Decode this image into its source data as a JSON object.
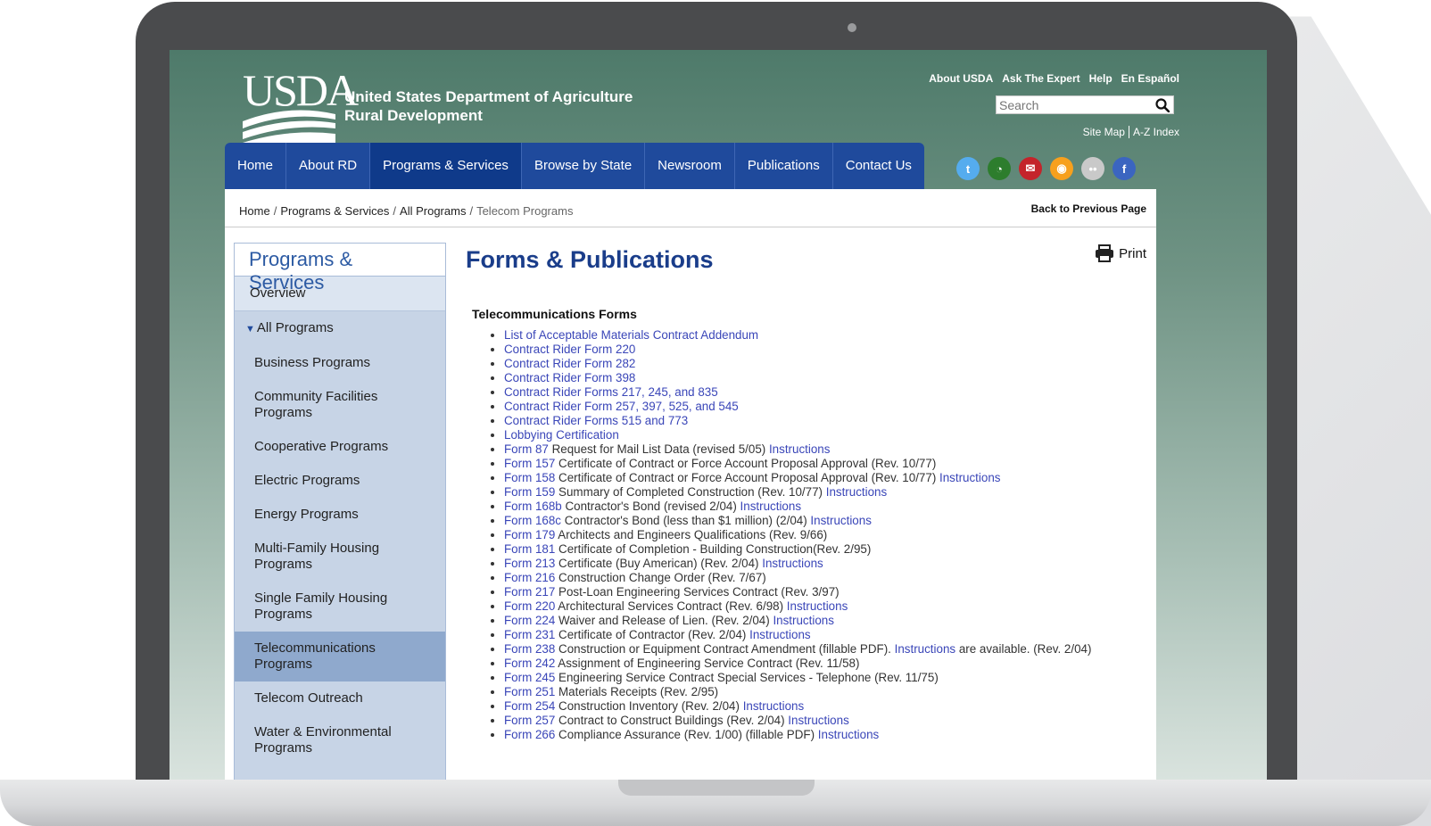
{
  "header": {
    "logo_text": "USDA",
    "agency_line1": "United States Department of Agriculture",
    "agency_line2": "Rural Development",
    "util_links": [
      "About USDA",
      "Ask The Expert",
      "Help",
      "En Español"
    ],
    "search_placeholder": "Search",
    "site_map": "Site Map",
    "az_index": "A-Z Index"
  },
  "nav": {
    "items": [
      "Home",
      "About RD",
      "Programs & Services",
      "Browse by State",
      "Newsroom",
      "Publications",
      "Contact Us"
    ],
    "active": "Programs & Services"
  },
  "social": [
    {
      "name": "twitter-icon",
      "glyph": "t",
      "color": "#55acee"
    },
    {
      "name": "feed-icon",
      "glyph": "◔",
      "color": "#2d7d2d"
    },
    {
      "name": "email-icon",
      "glyph": "✉",
      "color": "#c4242b"
    },
    {
      "name": "rss-icon",
      "glyph": "◉",
      "color": "#f7a01d"
    },
    {
      "name": "flickr-icon",
      "glyph": "••",
      "color": "#c9c9c9"
    },
    {
      "name": "facebook-icon",
      "glyph": "f",
      "color": "#3b65c0"
    }
  ],
  "breadcrumb": {
    "items": [
      "Home",
      "Programs & Services",
      "All Programs"
    ],
    "current": "Telecom Programs",
    "back": "Back to Previous Page"
  },
  "sidebar": {
    "title": "Programs & Services",
    "overview": "Overview",
    "all_programs": "All Programs",
    "items": [
      "Business Programs",
      "Community Facilities Programs",
      "Cooperative Programs",
      "Electric Programs",
      "Energy Programs",
      "Multi-Family Housing Programs",
      "Single Family Housing Programs",
      "Telecommunications Programs",
      "Telecom Outreach",
      "Water & Environmental Programs"
    ],
    "active": "Telecommunications Programs"
  },
  "main": {
    "title": "Forms & Publications",
    "print": "Print",
    "section_title": "Telecommunications Forms",
    "forms": [
      {
        "link": "List of Acceptable Materials Contract Addendum"
      },
      {
        "link": "Contract Rider Form 220"
      },
      {
        "link": "Contract Rider Form 282"
      },
      {
        "link": "Contract Rider Form 398"
      },
      {
        "link": "Contract Rider Forms 217, 245, and 835"
      },
      {
        "link": "Contract Rider Form 257, 397, 525, and 545"
      },
      {
        "link": "Contract Rider Forms 515 and 773"
      },
      {
        "link": "Lobbying Certification"
      },
      {
        "link": "Form 87",
        "text": " Request for Mail List Data (revised 5/05) ",
        "instr": "Instructions"
      },
      {
        "link": "Form 157",
        "text": " Certificate of Contract or Force Account Proposal Approval (Rev. 10/77)"
      },
      {
        "link": "Form 158",
        "text": " Certificate of Contract or Force Account Proposal Approval (Rev. 10/77) ",
        "instr": "Instructions"
      },
      {
        "link": "Form 159",
        "text": " Summary of Completed Construction (Rev. 10/77) ",
        "instr": "Instructions"
      },
      {
        "link": "Form 168b",
        "text": " Contractor's Bond (revised 2/04) ",
        "instr": "Instructions"
      },
      {
        "link": "Form 168c",
        "text": " Contractor's Bond (less than $1 million) (2/04) ",
        "instr": "Instructions"
      },
      {
        "link": "Form 179",
        "text": " Architects and Engineers Qualifications (Rev. 9/66)"
      },
      {
        "link": "Form 181",
        "text": " Certificate of Completion - Building Construction(Rev. 2/95)"
      },
      {
        "link": "Form 213",
        "text": " Certificate (Buy American) (Rev. 2/04) ",
        "instr": "Instructions"
      },
      {
        "link": "Form 216",
        "text": " Construction Change Order (Rev. 7/67)"
      },
      {
        "link": "Form 217",
        "text": " Post-Loan Engineering Services Contract (Rev. 3/97)"
      },
      {
        "link": "Form 220",
        "text": " Architectural Services Contract (Rev. 6/98) ",
        "instr": "Instructions"
      },
      {
        "link": "Form 224",
        "text": " Waiver and Release of Lien. (Rev. 2/04) ",
        "instr": "Instructions"
      },
      {
        "link": "Form 231",
        "text": " Certificate of Contractor (Rev. 2/04) ",
        "instr": "Instructions"
      },
      {
        "link": "Form 238",
        "text": " Construction or Equipment Contract Amendment (fillable PDF). ",
        "instr": "Instructions",
        "after": " are available. (Rev. 2/04)"
      },
      {
        "link": "Form 242",
        "text": " Assignment of Engineering Service Contract (Rev. 11/58)"
      },
      {
        "link": "Form 245",
        "text": " Engineering Service Contract Special Services - Telephone (Rev. 11/75)"
      },
      {
        "link": "Form 251",
        "text": " Materials Receipts (Rev. 2/95)"
      },
      {
        "link": "Form 254",
        "text": " Construction Inventory (Rev. 2/04) ",
        "instr": "Instructions"
      },
      {
        "link": "Form 257",
        "text": " Contract to Construct Buildings (Rev. 2/04) ",
        "instr": "Instructions"
      },
      {
        "link": "Form 266",
        "text": " Compliance Assurance (Rev. 1/00) (fillable PDF) ",
        "instr": "Instructions"
      }
    ]
  }
}
